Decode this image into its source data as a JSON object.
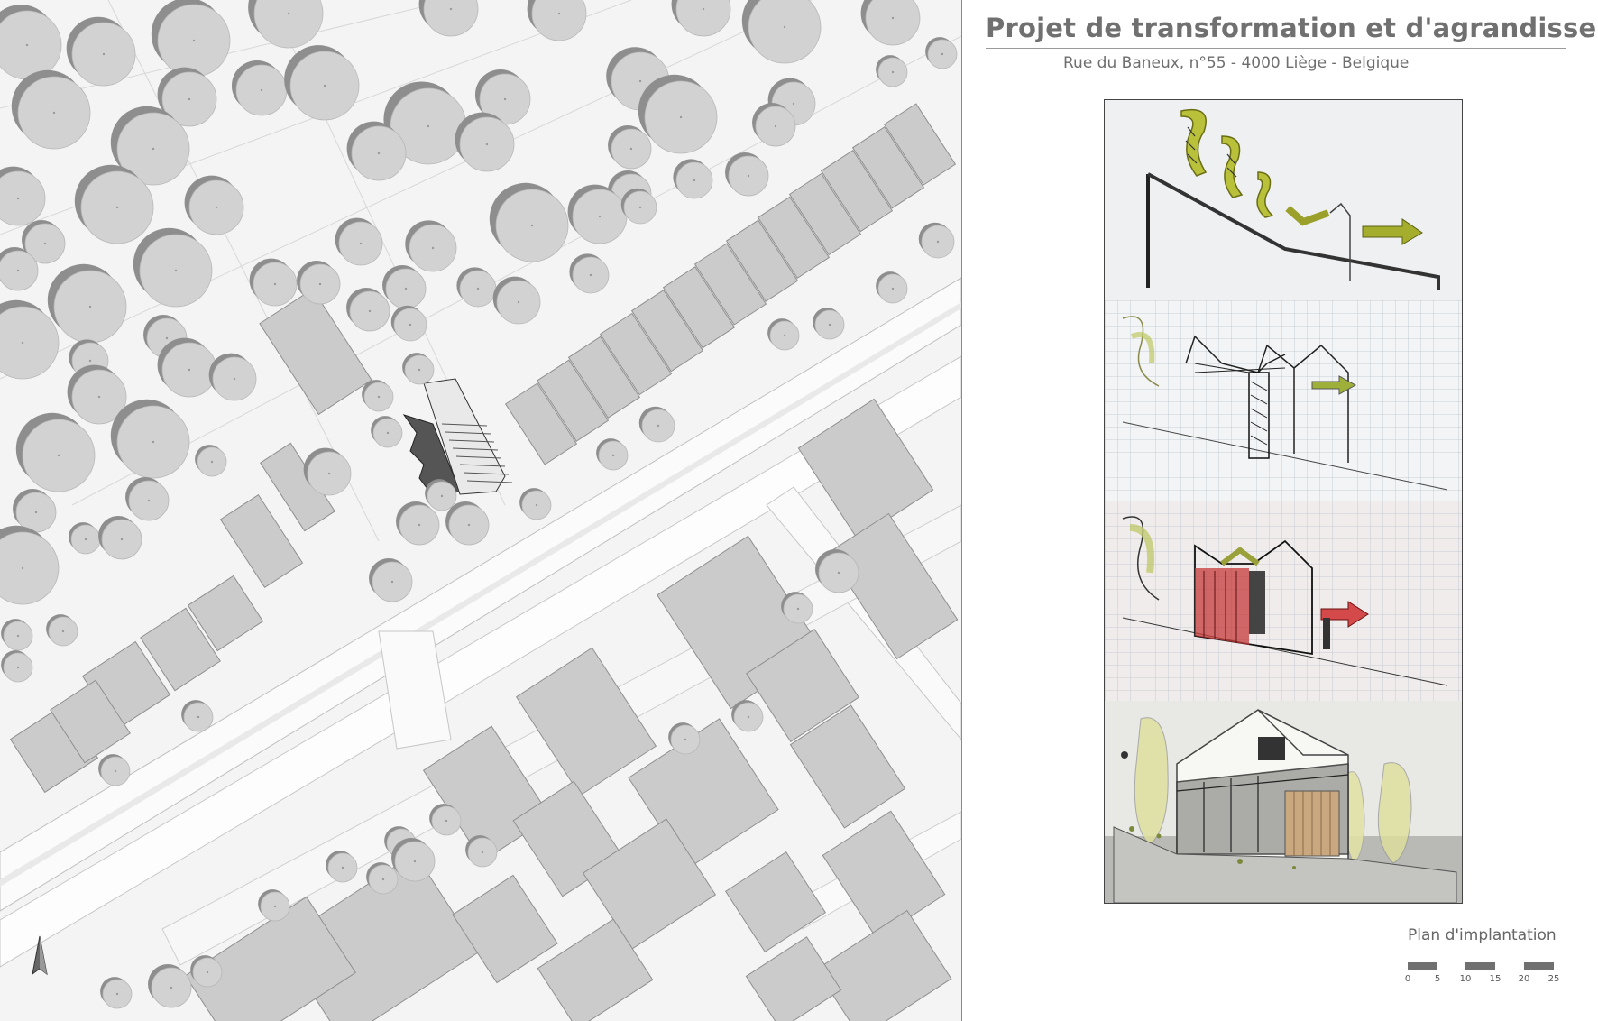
{
  "header": {
    "title": "Projet de transformation et d'agrandissement",
    "address": "Rue du Baneux, n°55 - 4000 Liège - Belgique"
  },
  "site_plan": {
    "north_arrow_icon": "north-arrow-icon",
    "colors": {
      "background": "#f4f4f4",
      "building": "#cbcbcb",
      "road": "#ffffff",
      "tree": "#d2d2d2",
      "tree_shadow": "#8e8e8e",
      "project": "#555555"
    }
  },
  "sketches": [
    {
      "name": "concept-sketch-slope-arrows"
    },
    {
      "name": "concept-sketch-grid-section"
    },
    {
      "name": "concept-sketch-colored-section"
    },
    {
      "name": "perspective-sketch-house"
    }
  ],
  "legend": {
    "title": "Plan d'implantation",
    "scale_ticks": [
      "0",
      "5",
      "10",
      "15",
      "20",
      "25"
    ]
  }
}
